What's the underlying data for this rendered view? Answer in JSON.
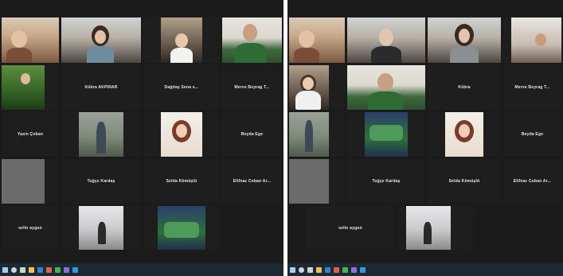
{
  "left": {
    "tiles": {
      "r2c2": "Kübra AKPINAR",
      "r2c3": "Dağdaş Sena s...",
      "r2c4": "Merve Beyrag T...",
      "r3c1": "Yasin Çoban",
      "r3c4": "Beyda Ege",
      "r4c2": "Tuğçe Kardaş",
      "r4c3": "Selda Kömüşlü",
      "r4c4": "Elifnaz Coban Ar...",
      "r5c1": "selin aygun"
    }
  },
  "right": {
    "tiles": {
      "r1c3": "Kübra",
      "r2c4": "Merve Beyrag T...",
      "r3c4": "Beyda Ege",
      "r4c2": "Tuğçe Kardaş",
      "r4c3": "Selda Kömüşlü",
      "r4c4": "Elifnaz Coban Ar...",
      "r5c1": "selin aygun"
    }
  },
  "colors": {
    "background": "#1b1b1b",
    "active_speaker_border": "#c6e03a",
    "taskbar": "#1c2a33"
  },
  "icons": [
    "windows-start-icon",
    "search-icon",
    "task-view-icon",
    "file-explorer-icon",
    "edge-icon",
    "mail-icon",
    "store-icon",
    "zoom-icon"
  ]
}
